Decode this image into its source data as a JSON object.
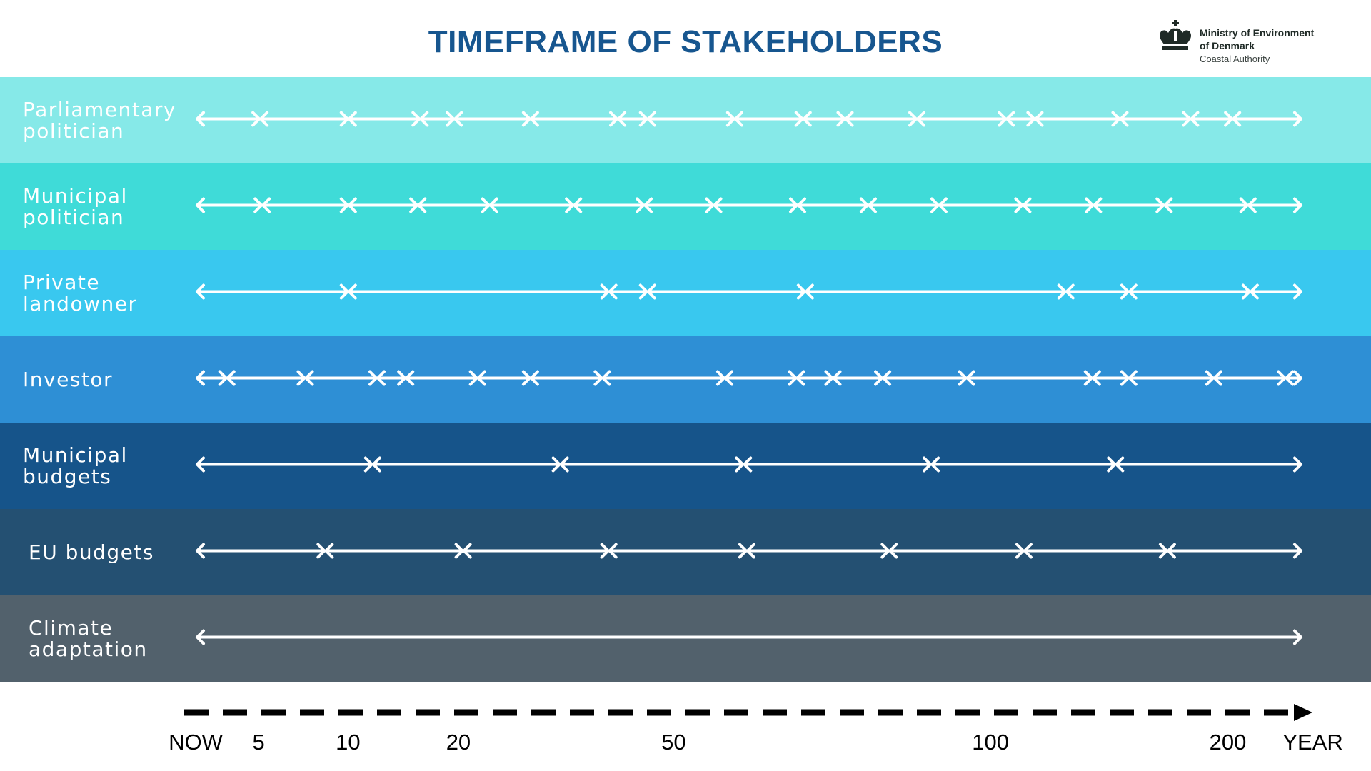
{
  "title": "TIMEFRAME OF STAKEHOLDERS",
  "logo": {
    "icon": "crown-icon",
    "line1": "Ministry of Environment",
    "line2": "of Denmark",
    "line3": "Coastal Authority"
  },
  "chart_data": {
    "type": "timeline",
    "title": "TIMEFRAME OF STAKEHOLDERS",
    "xlabel": "YEAR",
    "axis_ticks": [
      {
        "label": "NOW",
        "pos": 0.0
      },
      {
        "label": "5",
        "pos": 0.057
      },
      {
        "label": "10",
        "pos": 0.138
      },
      {
        "label": "20",
        "pos": 0.238
      },
      {
        "label": "50",
        "pos": 0.433
      },
      {
        "label": "100",
        "pos": 0.72
      },
      {
        "label": "200",
        "pos": 0.935
      },
      {
        "label": "YEAR",
        "pos": 1.012
      }
    ],
    "rows": [
      {
        "name": "Parliamentary\npolitician",
        "color": "#86e9e8",
        "markers": [
          0.057,
          0.137,
          0.202,
          0.233,
          0.302,
          0.381,
          0.408,
          0.487,
          0.549,
          0.587,
          0.652,
          0.733,
          0.759,
          0.836,
          0.9,
          0.938
        ]
      },
      {
        "name": "Municipal\npolitician",
        "color": "#3fdbd8",
        "markers": [
          0.059,
          0.137,
          0.2,
          0.265,
          0.341,
          0.405,
          0.468,
          0.544,
          0.608,
          0.672,
          0.748,
          0.812,
          0.876,
          0.952
        ]
      },
      {
        "name": "Private\nlandowner",
        "color": "#39c8ef",
        "markers": [
          0.137,
          0.373,
          0.408,
          0.551,
          0.787,
          0.844,
          0.954
        ]
      },
      {
        "name": "Investor",
        "color": "#2e8fd5",
        "markers": [
          0.027,
          0.098,
          0.163,
          0.189,
          0.254,
          0.302,
          0.367,
          0.478,
          0.543,
          0.576,
          0.621,
          0.697,
          0.811,
          0.844,
          0.921,
          0.986
        ]
      },
      {
        "name": "Municipal\nbudgets",
        "color": "#16548a",
        "markers": [
          0.159,
          0.329,
          0.495,
          0.665,
          0.832
        ]
      },
      {
        "name": "EU budgets",
        "color": "#245072",
        "markers": [
          0.116,
          0.241,
          0.373,
          0.498,
          0.627,
          0.749,
          0.879
        ]
      },
      {
        "name": "Climate\nadaptation",
        "color": "#52616c",
        "markers": []
      }
    ]
  }
}
